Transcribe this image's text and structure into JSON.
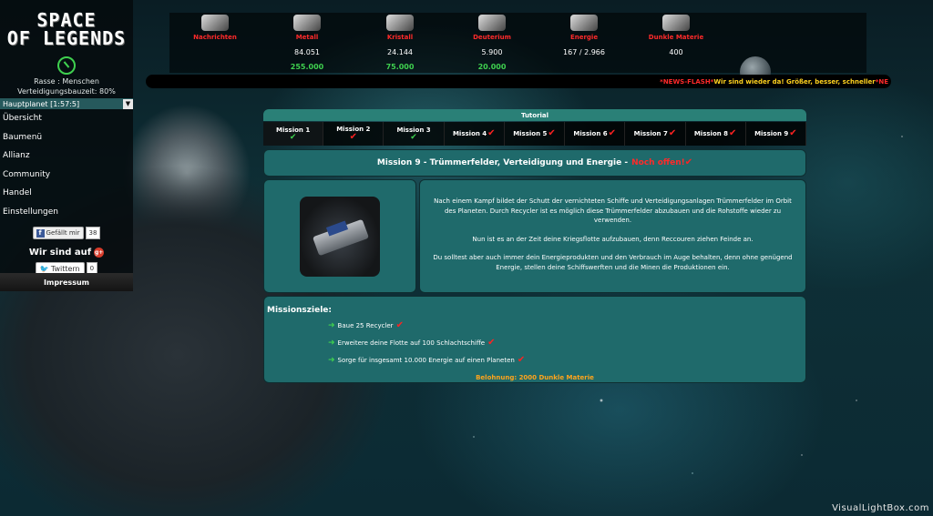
{
  "brand": {
    "logo_line1": "SPACE",
    "logo_line2": "OF LEGENDS"
  },
  "sidebar": {
    "race": "Rasse : Menschen",
    "defense_time": "Verteidigungsbauzeit: 80%",
    "planet": "Hauptplanet [1:57:5]",
    "nav": [
      "Übersicht",
      "Baumenü",
      "Allianz",
      "Community",
      "Handel",
      "Einstellungen"
    ],
    "facebook_label": "Gefällt mir",
    "facebook_count": "38",
    "follow_label": "Wir sind auf",
    "twitter_label": "Twittern",
    "twitter_count": "0",
    "impressum": "Impressum"
  },
  "resources": [
    {
      "name": "Nachrichten",
      "value": "",
      "production": ""
    },
    {
      "name": "Metall",
      "value": "84.051",
      "production": "255.000"
    },
    {
      "name": "Kristall",
      "value": "24.144",
      "production": "75.000"
    },
    {
      "name": "Deuterium",
      "value": "5.900",
      "production": "20.000"
    },
    {
      "name": "Energie",
      "value": "167 / 2.966",
      "production": ""
    },
    {
      "name": "Dunkle Materie",
      "value": "400",
      "production": ""
    }
  ],
  "newsflash": {
    "tag": "*NEWS-FLASH*",
    "text": " Wir sind wieder da! Größer, besser, schneller",
    "tail": "*NE"
  },
  "tutorial": {
    "header": "Tutorial",
    "tabs": [
      {
        "label": "Mission 1",
        "status": "done"
      },
      {
        "label": "Mission 2",
        "status": "open"
      },
      {
        "label": "Mission 3",
        "status": "done"
      },
      {
        "label": "Mission 4",
        "status": "open"
      },
      {
        "label": "Mission 5",
        "status": "open"
      },
      {
        "label": "Mission 6",
        "status": "open"
      },
      {
        "label": "Mission 7",
        "status": "open"
      },
      {
        "label": "Mission 8",
        "status": "open"
      },
      {
        "label": "Mission 9",
        "status": "open"
      }
    ],
    "mission_title": "Mission 9 - Trümmerfelder, Verteidigung und Energie -",
    "mission_status": "Noch offen!",
    "paragraphs": [
      "Nach einem Kampf bildet der Schutt der vernichteten Schiffe und Verteidigungsanlagen Trümmerfelder im Orbit des Planeten. Durch Recycler ist es möglich diese Trümmerfelder abzubauen und die Rohstoffe wieder zu verwenden.",
      "Nun ist es an der Zeit deine Kriegsflotte aufzubauen, denn Reccouren ziehen Feinde an.",
      "Du solltest aber auch immer dein Energieprodukten und den Verbrauch im Auge behalten, denn ohne genügend Energie, stellen deine Schiffswerften und die Minen die Produktionen ein."
    ],
    "goals_title": "Missionsziele:",
    "goals": [
      "Baue 25 Recycler",
      "Erweitere deine Flotte auf 100 Schlachtschiffe",
      "Sorge für insgesamt 10.000 Energie auf einen Planeten"
    ],
    "reward": "Belohnung: 2000 Dunkle Materie"
  },
  "watermark": "VisualLightBox.com",
  "colors": {
    "accent_red": "#ff2a2a",
    "accent_green": "#3fd04f",
    "panel": "#1f6a6b",
    "reward": "#ffa41c"
  }
}
